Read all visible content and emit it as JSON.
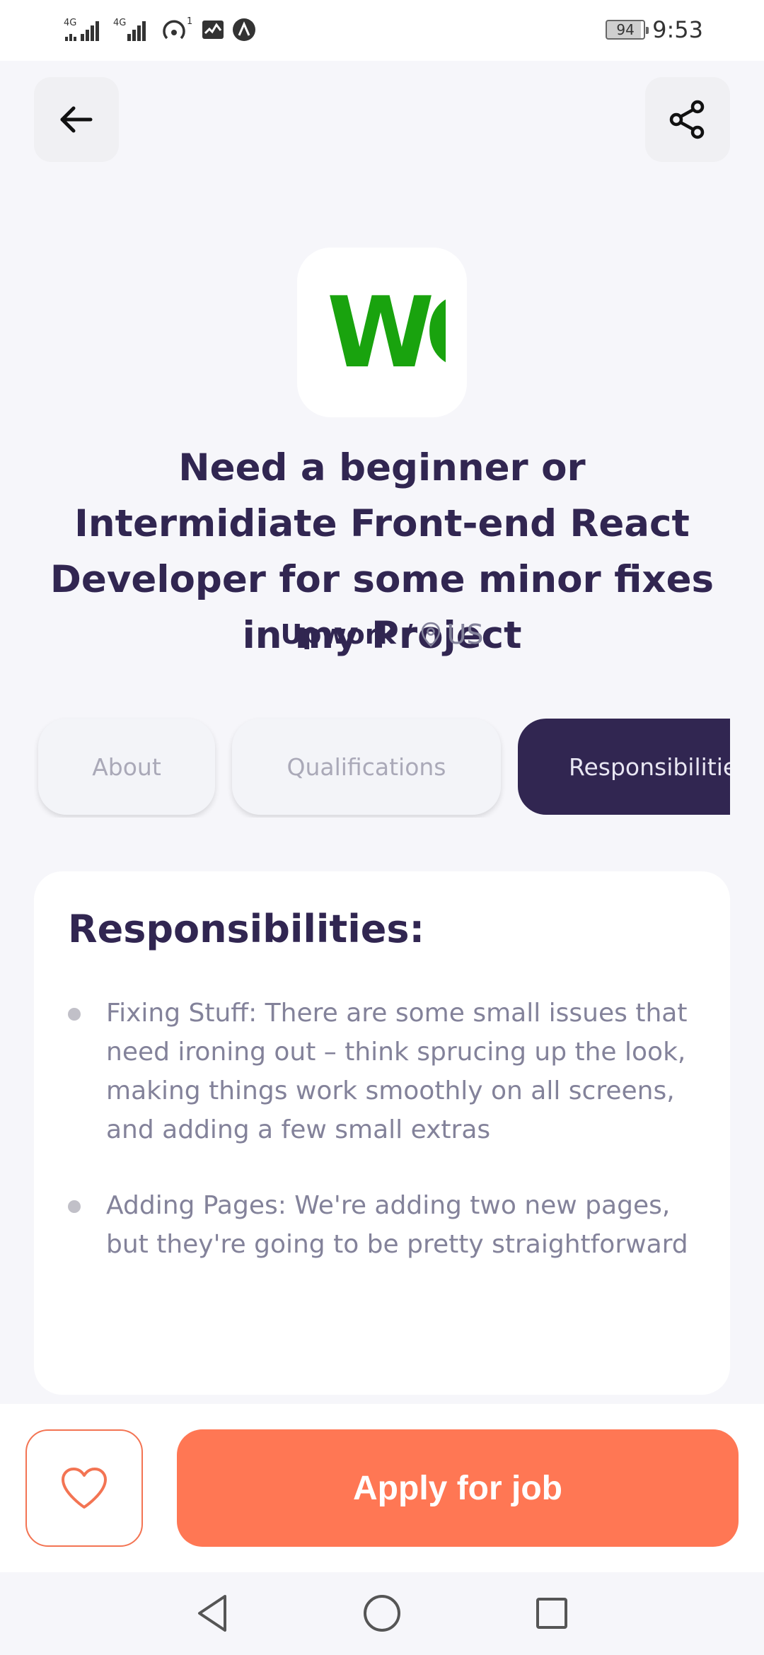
{
  "status_bar": {
    "network_1": "4G",
    "network_2": "4G",
    "hotspot_count": "1",
    "battery_level": "94",
    "time": "9:53"
  },
  "header": {
    "back_icon": "arrow-left-icon",
    "share_icon": "share-icon"
  },
  "job": {
    "logo_text": "WC",
    "logo_color": "#19A30E",
    "title": "Need a beginner or Intermidiate Front-end React Developer for some minor fixes in my Project",
    "company": "Upwork",
    "separator": "/",
    "location": "US"
  },
  "tabs": {
    "items": [
      {
        "label": "About",
        "active": false
      },
      {
        "label": "Qualifications",
        "active": false
      },
      {
        "label": "Responsibilities",
        "active": true
      }
    ]
  },
  "responsibilities": {
    "heading": "Responsibilities:",
    "items": [
      "Fixing Stuff: There are some small issues that need ironing out – think sprucing up the look, making things work smoothly on all screens, and adding a few small extras",
      "Adding Pages: We're adding two new pages, but they're going to be pretty straightforward"
    ]
  },
  "footer": {
    "like_icon": "heart-outline-icon",
    "apply_label": "Apply for job"
  },
  "colors": {
    "primary": "#312651",
    "accent": "#FF7754",
    "gray": "#83829A",
    "background": "#F6F6FA"
  }
}
